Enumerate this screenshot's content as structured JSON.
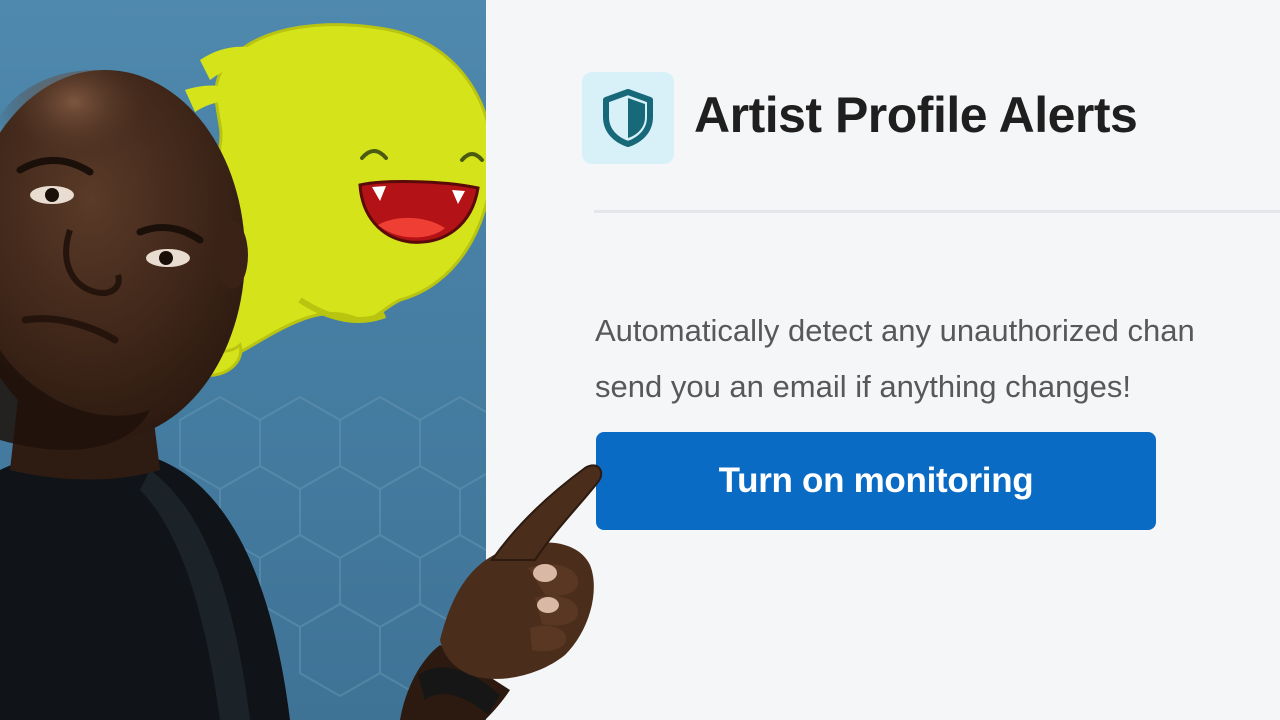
{
  "alert": {
    "title": "Artist Profile Alerts",
    "description_line1": "Automatically detect any unauthorized chan",
    "description_line2": "send you an email if anything changes!",
    "button_label": "Turn on monitoring",
    "icon": "shield-icon"
  },
  "colors": {
    "button_blue": "#0a6bc5",
    "icon_tile": "#d8f1f8",
    "shield_teal": "#17697a",
    "mascot_green": "#d5e31a",
    "background_blue": "#4a84a8"
  }
}
